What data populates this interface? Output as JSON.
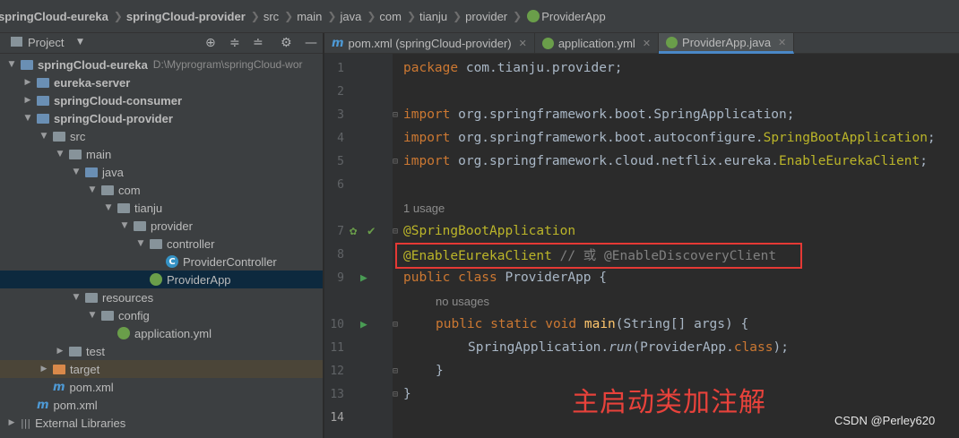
{
  "breadcrumb": [
    "springCloud-eureka",
    "springCloud-provider",
    "src",
    "main",
    "java",
    "com",
    "tianju",
    "provider",
    "ProviderApp"
  ],
  "project_panel": {
    "title": "Project",
    "tree": [
      {
        "label": "springCloud-eureka",
        "hint": "D:\\Myprogram\\springCloud-wor"
      },
      {
        "label": "eureka-server"
      },
      {
        "label": "springCloud-consumer"
      },
      {
        "label": "springCloud-provider"
      },
      {
        "label": "src"
      },
      {
        "label": "main"
      },
      {
        "label": "java"
      },
      {
        "label": "com"
      },
      {
        "label": "tianju"
      },
      {
        "label": "provider"
      },
      {
        "label": "controller"
      },
      {
        "label": "ProviderController"
      },
      {
        "label": "ProviderApp"
      },
      {
        "label": "resources"
      },
      {
        "label": "config"
      },
      {
        "label": "application.yml"
      },
      {
        "label": "test"
      },
      {
        "label": "target"
      },
      {
        "label": "pom.xml"
      },
      {
        "label": "pom.xml"
      },
      {
        "label": "External Libraries"
      }
    ]
  },
  "tabs": [
    {
      "label": "pom.xml (springCloud-provider)"
    },
    {
      "label": "application.yml"
    },
    {
      "label": "ProviderApp.java"
    }
  ],
  "editor": {
    "line_numbers": [
      "1",
      "2",
      "3",
      "4",
      "5",
      "6",
      "7",
      "8",
      "9",
      "10",
      "11",
      "12",
      "13",
      "14"
    ],
    "usage_hint_1": "1 usage",
    "usage_hint_2": "no usages",
    "code": {
      "l1_kw": "package",
      "l1_rest": " com.tianju.provider;",
      "l3_kw": "import",
      "l3_rest": " org.springframework.boot.SpringApplication;",
      "l4_kw": "import",
      "l4_rest": " org.springframework.boot.autoconfigure.",
      "l4_ann": "SpringBootApplication",
      "l4_end": ";",
      "l5_kw": "import",
      "l5_rest": " org.springframework.cloud.netflix.eureka.",
      "l5_ann": "EnableEurekaClient",
      "l5_end": ";",
      "l7_ann": "@SpringBootApplication",
      "l8_ann": "@EnableEurekaClient",
      "l8_cmt": " // 或 @EnableDiscoveryClient",
      "l9_kw": "public class",
      "l9_rest": " ProviderApp {",
      "l10_kw": "public static void",
      "l10_fn": " main",
      "l10_rest": "(String[] args) {",
      "l11_a": "SpringApplication.",
      "l11_run": "run",
      "l11_b": "(ProviderApp.",
      "l11_kw": "class",
      "l11_c": ");",
      "l12": "}",
      "l13": "}"
    }
  },
  "annotation_text": "主启动类加注解",
  "watermark": "CSDN @Perley620",
  "colors": {
    "keyword": "#cc7832",
    "annotation": "#bbb529",
    "comment": "#808080",
    "highlight_box": "#e53935",
    "annotation_text": "#e8423b"
  }
}
